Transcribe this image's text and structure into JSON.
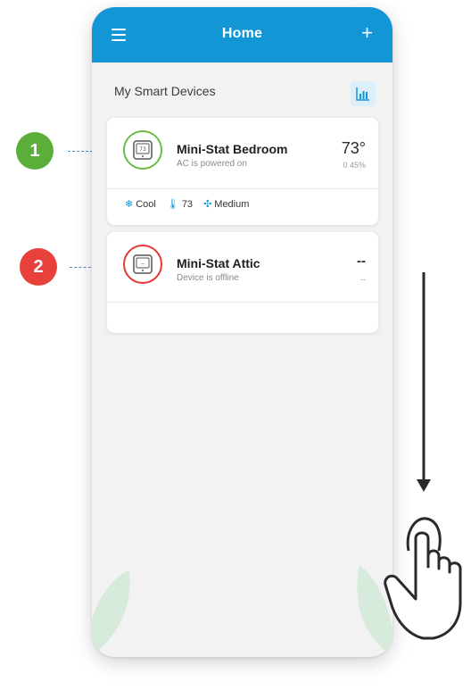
{
  "header": {
    "title": "Home",
    "menu_icon": "menu-icon",
    "add_label": "+"
  },
  "section": {
    "title": "My Smart Devices",
    "chart_icon": "bar-chart-icon"
  },
  "devices": [
    {
      "badge": "1",
      "name": "Mini-Stat Bedroom",
      "status": "AC is powered on",
      "temperature": "73°",
      "humidity": "0 45%",
      "status_color": "#69bd45",
      "settings": [
        {
          "icon": "snowflake-icon",
          "label": "Cool"
        },
        {
          "icon": "thermometer-icon",
          "label": "73"
        },
        {
          "icon": "fan-icon",
          "label": "Medium"
        }
      ]
    },
    {
      "badge": "2",
      "name": "Mini-Stat Attic",
      "status": "Device is offline",
      "temperature": "--",
      "humidity": "--",
      "status_color": "#e53935"
    }
  ],
  "colors": {
    "appbar": "#1296d6",
    "badge_online": "#5cae3b",
    "badge_offline": "#e8403a"
  }
}
